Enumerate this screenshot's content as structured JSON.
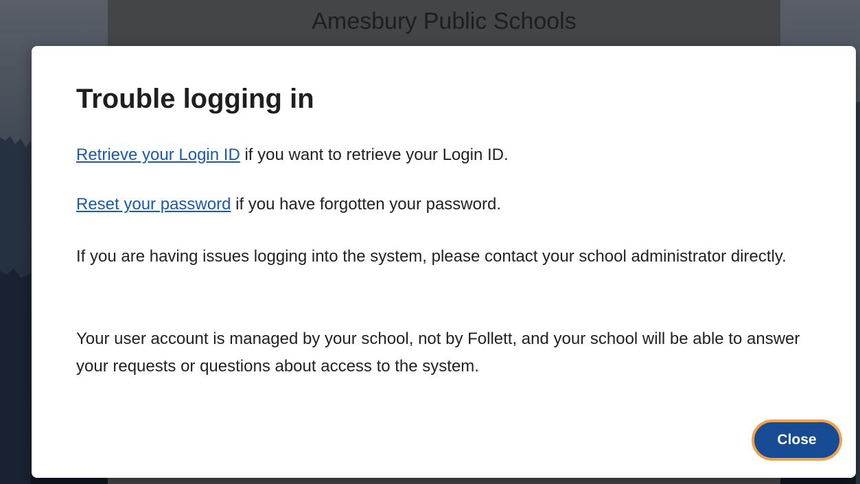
{
  "background": {
    "header_title": "Amesbury Public Schools"
  },
  "modal": {
    "title": "Trouble logging in",
    "retrieve": {
      "link_text": "Retrieve your Login ID",
      "rest_text": " if you want to retrieve your Login ID."
    },
    "reset": {
      "link_text": "Reset your password",
      "rest_text": " if you have forgotten your password."
    },
    "issues_text": "If you are having issues logging into the system, please contact your school administrator directly.",
    "account_text": "Your user account is managed by your school, not by Follett, and your school will be able to answer your requests or questions about access to the system.",
    "close_label": "Close"
  },
  "colors": {
    "link": "#1a5aab",
    "button_bg": "#174c95",
    "focus_ring": "#f2a04a"
  }
}
